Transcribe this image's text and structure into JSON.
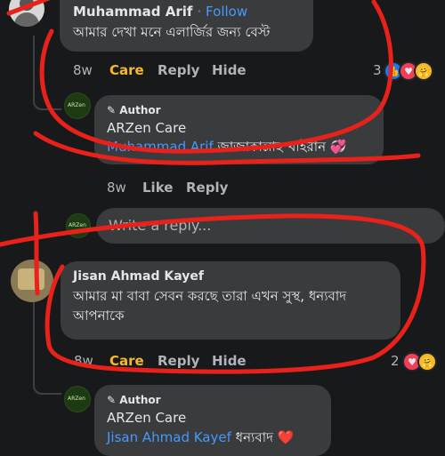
{
  "comment1": {
    "name": "Muhammad Arif",
    "follow": "· Follow",
    "text": "আমার দেখা মনে এলার্জির জন্য বেস্ট",
    "time": "8w",
    "care": "Care",
    "reply": "Reply",
    "hide": "Hide",
    "reaction_count": "3"
  },
  "reply1": {
    "author_badge": "Author",
    "name": "ARZen Care",
    "mention": "Muhammad Arif",
    "text": " জাজাকাল্লাহ খাইরান 💞",
    "time": "8w",
    "like": "Like",
    "reply": "Reply"
  },
  "reply_input": {
    "placeholder": "Write a reply..."
  },
  "comment2": {
    "name": "Jisan Ahmad Kayef",
    "text": "আমার মা বাবা সেবন করছে তারা এখন সুস্থ, ধন্যবাদ আপনাকে",
    "time": "8w",
    "care": "Care",
    "reply": "Reply",
    "hide": "Hide",
    "reaction_count": "2"
  },
  "reply2": {
    "author_badge": "Author",
    "name": "ARZen Care",
    "mention": "Jisan Ahmad Kayef",
    "text": " ধন্যবাদ ❤️"
  },
  "colors": {
    "background": "#18191a",
    "bubble": "#3a3b3c",
    "care": "#f7b928",
    "mention": "#4599ff",
    "annotation": "#e8221b"
  },
  "icons": [
    "pencil-icon",
    "like-reaction-icon",
    "love-reaction-icon",
    "care-reaction-icon"
  ]
}
